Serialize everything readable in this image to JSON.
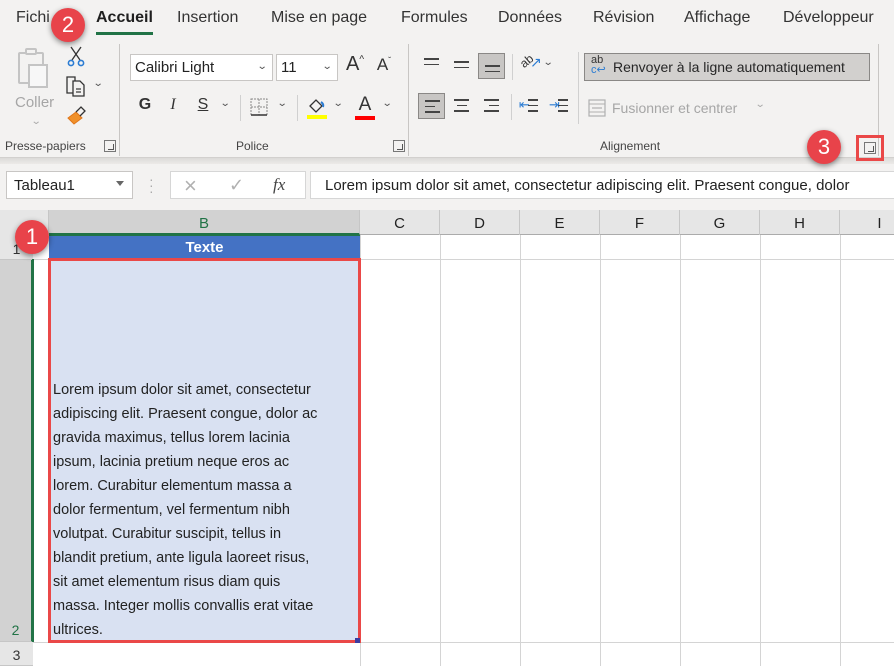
{
  "tabs": [
    {
      "label": "Fichi",
      "active": false
    },
    {
      "label": "Accueil",
      "active": true
    },
    {
      "label": "Insertion",
      "active": false
    },
    {
      "label": "Mise en page",
      "active": false
    },
    {
      "label": "Formules",
      "active": false
    },
    {
      "label": "Données",
      "active": false
    },
    {
      "label": "Révision",
      "active": false
    },
    {
      "label": "Affichage",
      "active": false
    },
    {
      "label": "Développeur",
      "active": false
    }
  ],
  "ribbon": {
    "clipboard": {
      "paste_label": "Coller",
      "group_label": "Presse-papiers",
      "icons": [
        "paste-icon",
        "cut-icon",
        "copy-icon",
        "format-painter-icon"
      ]
    },
    "font": {
      "font_name": "Calibri Light",
      "font_size": "11",
      "grow_label": "A",
      "shrink_label": "A",
      "bold_label": "G",
      "italic_label": "I",
      "underline_label": "S",
      "font_color_label": "A",
      "highlight_color": "#ffff00",
      "font_color": "#ff0000",
      "group_label": "Police"
    },
    "alignment": {
      "wrap_label": "Renvoyer à la ligne automatiquement",
      "wrap_icon_text": "ab",
      "merge_label": "Fusionner et centrer",
      "orientation_icon_text": "ab",
      "group_label": "Alignement",
      "bottom_align_active": true,
      "left_align_active": true
    }
  },
  "formula_bar": {
    "name_box": "Tableau1",
    "fx_label": "fx",
    "cancel_icon": "×",
    "enter_icon": "✓",
    "content": "Lorem ipsum dolor sit amet, consectetur adipiscing elit. Praesent congue, dolor"
  },
  "grid": {
    "columns": [
      "B",
      "C",
      "D",
      "E",
      "F",
      "G",
      "H",
      "I"
    ],
    "selected_column": "B",
    "rows": [
      "1",
      "2",
      "3"
    ],
    "selected_row": "2",
    "header_cell": "Texte",
    "cell_lines": [
      "Lorem ipsum dolor sit amet, consectetur",
      "adipiscing elit. Praesent congue, dolor ac",
      "gravida maximus, tellus lorem lacinia",
      "ipsum, lacinia pretium neque eros ac",
      "lorem. Curabitur elementum massa a",
      "dolor fermentum, vel fermentum nibh",
      "volutpat. Curabitur suscipit, tellus in",
      "blandit pretium, ante ligula laoreet risus,",
      "sit amet elementum risus diam quis",
      "massa. Integer mollis convallis erat vitae",
      "ultrices."
    ]
  },
  "callouts": [
    "1",
    "2",
    "3"
  ],
  "colors": {
    "accent_green": "#217346",
    "table_header": "#4472c4",
    "table_row": "#d9e1f2",
    "callout_red": "#e8434a"
  }
}
